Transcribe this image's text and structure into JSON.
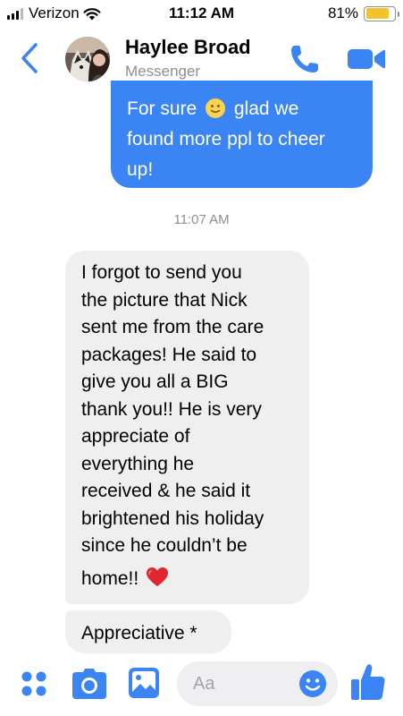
{
  "status_bar": {
    "carrier": "Verizon",
    "time": "11:12 AM",
    "battery_percent": "81%",
    "battery_level": 0.81,
    "battery_color": "#f4c430",
    "signal_bars_filled": 3,
    "signal_bars_total": 4
  },
  "header": {
    "contact_name": "Haylee Broad",
    "subtitle": "Messenger",
    "icons": [
      "back-chevron-icon",
      "phone-icon",
      "video-camera-icon"
    ],
    "accent_color": "#3a85f3"
  },
  "conversation": {
    "outgoing_message": {
      "line1": "For sure",
      "line1_emoji": "slightly-smiling-face-emoji",
      "line1_rest": "glad we",
      "line2": "found more ppl to cheer",
      "line3": "up!",
      "bubble_color": "#3a85f3"
    },
    "timestamp": "11:07 AM",
    "incoming_message": {
      "text": "I forgot to send you\nthe picture that Nick\nsent me from the care\npackages! He said to\ngive you all a BIG\nthank you!! He is very\nappreciate of\neverything he\nreceived & he said it\nbrightened his holiday\nsince he couldn’t be",
      "last_line": "home!!",
      "last_line_emoji": "red-heart-emoji",
      "bubble_color": "#efeff0"
    },
    "incoming_message_2": {
      "text": "Appreciative *"
    }
  },
  "composer": {
    "placeholder": "Aa",
    "icons": [
      "apps-grid-icon",
      "camera-icon",
      "photo-gallery-icon",
      "emoji-icon",
      "thumbs-up-icon"
    ]
  }
}
